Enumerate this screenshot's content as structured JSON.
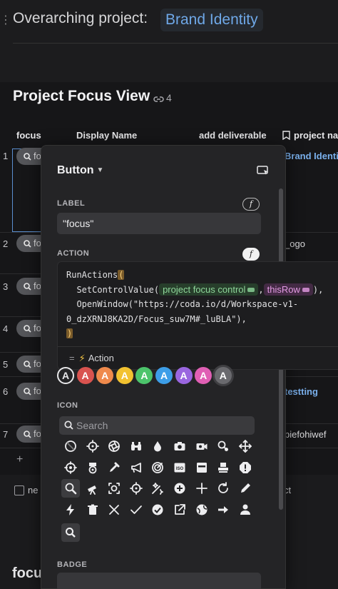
{
  "header": {
    "overarching_label": "Overarching project:",
    "brand_chip": "Brand Identity"
  },
  "table": {
    "title": "Project Focus View",
    "link_count": "4",
    "columns": [
      "focus",
      "Display Name",
      "add deliverable",
      "project na"
    ],
    "rows": [
      {
        "num": "1",
        "pill": "fo",
        "side": "Brand Identi",
        "side_style": "blue"
      },
      {
        "num": "2",
        "pill": "fo",
        "side": "_ogo",
        "side_style": "gray"
      },
      {
        "num": "3",
        "pill": "fo",
        "side": "",
        "side_style": "gray"
      },
      {
        "num": "4",
        "pill": "fo",
        "side": "",
        "side_style": "gray"
      },
      {
        "num": "5",
        "pill": "fo",
        "side": "",
        "side_style": "gray"
      },
      {
        "num": "6",
        "pill": "fo",
        "side": "testting",
        "side_style": "blue"
      },
      {
        "num": "7",
        "pill": "fo",
        "side": "piefohiwef",
        "side_style": "gray"
      }
    ],
    "add_row": "+"
  },
  "below": {
    "checkbox_text": "ne",
    "right_text": "ct",
    "next_section_partial": "focu"
  },
  "popover": {
    "title": "Button",
    "label_section": "LABEL",
    "label_value": "\"focus\"",
    "action_section": "ACTION",
    "formula_glyph": "f",
    "code": {
      "line1_fn": "RunActions",
      "line2_fn": "  SetControlValue",
      "token_control": "project focus control",
      "token_row": "thisRow",
      "line3": "  OpenWindow(\"https://coda.io/d/Workspace-v1-",
      "line4": "0_dzXRNJ8KA2D/Focus_suw7M#_luBLA\"),"
    },
    "result_eq": "=",
    "result_text": "Action",
    "swatches": [
      {
        "letter": "A",
        "color": "#1b1b1d",
        "outline": true
      },
      {
        "letter": "A",
        "color": "#d9534f"
      },
      {
        "letter": "A",
        "color": "#ef8a4c"
      },
      {
        "letter": "A",
        "color": "#f2c230"
      },
      {
        "letter": "A",
        "color": "#4cc46b"
      },
      {
        "letter": "A",
        "color": "#3d9ee8"
      },
      {
        "letter": "A",
        "color": "#9a66e0"
      },
      {
        "letter": "A",
        "color": "#e05fb4"
      },
      {
        "letter": "A",
        "color": "#6a6a6e",
        "selected": true
      }
    ],
    "icon_section": "ICON",
    "search_placeholder": "Search",
    "icons": [
      [
        "block-icon",
        "crosshair-icon",
        "aperture-icon",
        "binoculars-icon",
        "drop-icon",
        "camera-icon",
        "video-camera-icon",
        "search-settings-icon",
        "move-icon"
      ],
      [
        "target-icon",
        "badge-award-icon",
        "eyedropper-icon",
        "megaphone-icon",
        "radar-target-icon",
        "iso-icon",
        "window-icon",
        "stamp-icon",
        "alert-octagon-icon"
      ],
      [
        "search-icon",
        "telescope-icon",
        "screenshot-icon",
        "focus-rotate-icon",
        "ai-magic-icon",
        "add-circle-icon",
        "plus-icon",
        "refresh-icon",
        "pencil-icon"
      ],
      [
        "lightning-icon",
        "trash-icon",
        "close-icon",
        "check-icon",
        "check-circle-icon",
        "external-link-icon",
        "globe-icon",
        "arrow-right-icon",
        "person-icon"
      ]
    ],
    "selected_icon": "search-icon",
    "badge_section": "BADGE"
  }
}
